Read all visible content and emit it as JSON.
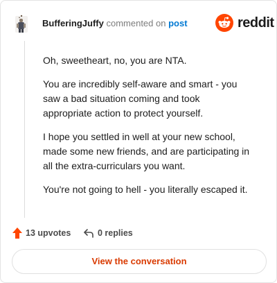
{
  "comment": {
    "username": "BufferingJuffy",
    "action_text": "commented on",
    "post_link": "post",
    "paragraphs": [
      "Oh, sweetheart, no, you are NTA.",
      "You are incredibly self-aware and smart - you saw a bad situation coming and took appropriate action to protect yourself.",
      "I hope you settled in well at your new school, made some new friends, and are participating in all the extra-curriculars you want.",
      "You're not going to hell - you literally escaped it."
    ]
  },
  "brand": {
    "name": "reddit",
    "icon": "reddit-snoo-icon",
    "color": "#ff4500"
  },
  "actions": {
    "upvotes": "13 upvotes",
    "replies": "0 replies",
    "upvote_icon": "upvote-arrow-icon",
    "upvote_color": "#ff4500",
    "reply_icon": "reply-arrow-icon"
  },
  "cta": {
    "label": "View the conversation",
    "color": "#d93a00"
  }
}
